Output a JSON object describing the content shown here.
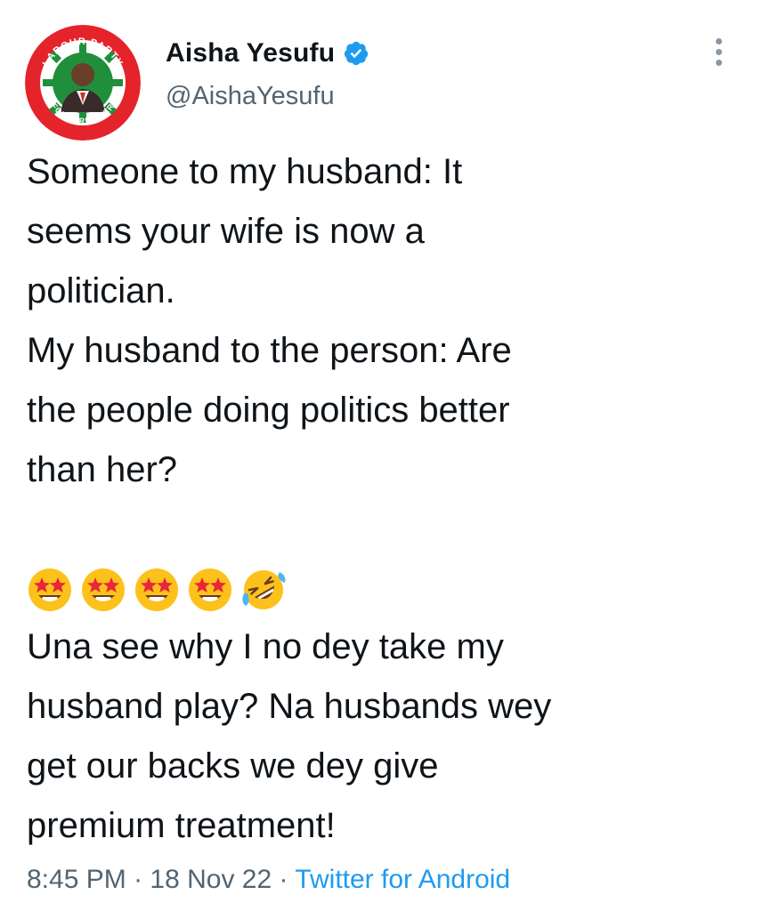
{
  "tweet": {
    "avatar_icon": "labour-party-avatar-icon",
    "avatar_text_top": "LABOUR PARTY",
    "avatar_text_bottom": "FORWARD EVER",
    "display_name": "Aisha Yesufu",
    "verified_icon": "verified-badge-icon",
    "handle": "@AishaYesufu",
    "more_icon": "more-options-icon",
    "body_lines": [
      "Someone to my husband: It",
      "seems your wife is now a",
      "politician.",
      "My husband to the person: Are",
      "the people doing politics better",
      "than her?",
      "",
      "",
      "Una see why I no dey take my",
      "husband play? Na husbands wey",
      "get our backs we dey give",
      "premium treatment!"
    ],
    "emojis": [
      "🤩",
      "🤩",
      "🤩",
      "🤩",
      "🤣"
    ],
    "emoji_icons": [
      "star-struck-icon",
      "star-struck-icon",
      "star-struck-icon",
      "star-struck-icon",
      "rofl-icon"
    ],
    "time": "8:45 PM",
    "separator": "·",
    "date": "18 Nov 22",
    "source": "Twitter for Android"
  },
  "colors": {
    "text": "#0f1419",
    "secondary": "#536471",
    "link": "#1d9bf0",
    "verified": "#1d9bf0"
  }
}
